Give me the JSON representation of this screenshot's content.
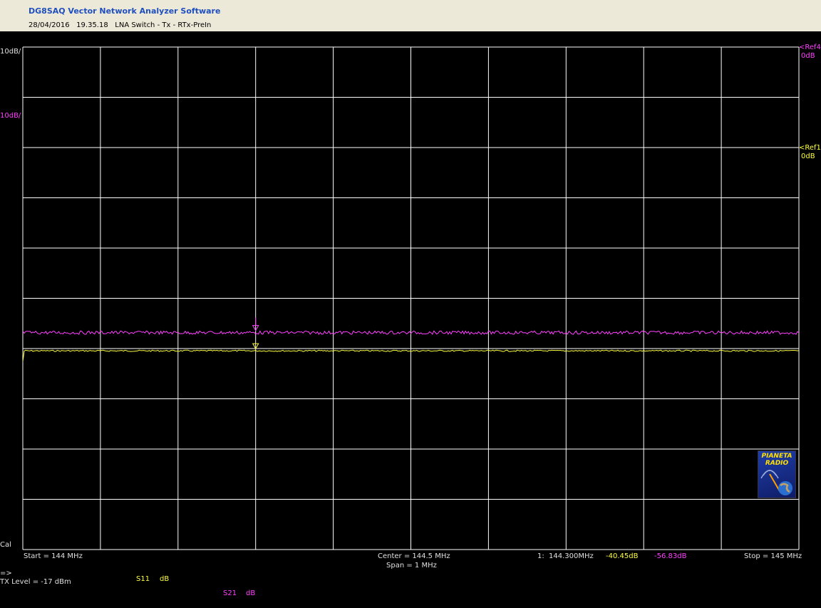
{
  "window": {
    "title": "DG8SAQ Vector Network Analyzer Software",
    "timestamp": "28/04/2016   19.35.18",
    "measurement": "LNA Switch - Tx - RTx-PreIn"
  },
  "colors": {
    "s11": "#ffff40",
    "s21": "#ff40ff",
    "grid": "#ffffff",
    "background": "#000000"
  },
  "left_labels": {
    "scale_s21_top": "10dB/",
    "scale_s21": "10dB/",
    "cal": "Cal"
  },
  "right_labels": {
    "ref4": "<Ref4",
    "ref4_val": "0dB",
    "ref1": "<Ref1",
    "ref1_val": "0dB"
  },
  "footer": {
    "start": "Start = 144 MHz",
    "center": "Center = 144.5 MHz",
    "span": "Span = 1 MHz",
    "stop": "Stop = 145 MHz",
    "marker_index": "1:",
    "marker_freq": "144.300MHz",
    "marker_s11": "-40.45dB",
    "marker_s21": "-56.83dB",
    "arrow": "=>",
    "tx_level": "TX Level = -17 dBm",
    "s11_name": "S11",
    "s11_unit": "dB",
    "s21_name": "S21",
    "s21_unit": "dB"
  },
  "logo": {
    "line1": "PIANETA",
    "line2": "RADIO"
  },
  "chart_data": {
    "type": "line",
    "x_unit": "MHz",
    "xlim": [
      144,
      145
    ],
    "grid": true,
    "grid_divisions": [
      10,
      10
    ],
    "marker": {
      "index": 1,
      "x": 144.3
    },
    "series": [
      {
        "name": "S11",
        "unit": "dB",
        "scale_per_div": 10,
        "ref": 0,
        "ref_div": 2,
        "level": -40.45,
        "color": "#ffff40"
      },
      {
        "name": "S21",
        "unit": "dB",
        "scale_per_div": 10,
        "ref": 0,
        "ref_div": 0,
        "level": -56.83,
        "color": "#ff40ff"
      }
    ]
  }
}
